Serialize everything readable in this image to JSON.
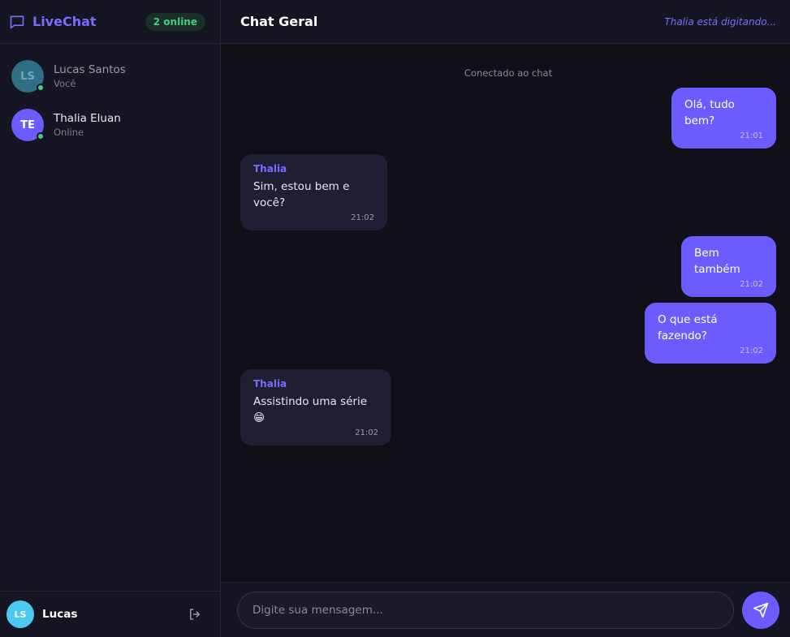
{
  "sidebar": {
    "brand": "LiveChat",
    "online_badge": "2 online",
    "users": [
      {
        "initials": "LS",
        "name": "Lucas Santos",
        "sub": "Você"
      },
      {
        "initials": "TE",
        "name": "Thalia Eluan",
        "sub": "Online"
      }
    ],
    "footer": {
      "initials": "LS",
      "name": "Lucas"
    }
  },
  "chat": {
    "title": "Chat Geral",
    "typing": "Thalia está digitando...",
    "system": "Conectado ao chat",
    "messages": [
      {
        "sender": "",
        "text": "Olá, tudo bem?",
        "time": "21:01"
      },
      {
        "sender": "Thalia",
        "text": "Sim, estou bem e você?",
        "time": "21:02"
      },
      {
        "sender": "",
        "text": "Bem também",
        "time": "21:02"
      },
      {
        "sender": "",
        "text": "O que está fazendo?",
        "time": "21:02"
      },
      {
        "sender": "Thalia",
        "text": "Assistindo uma série 😁",
        "time": "21:02"
      }
    ],
    "input_placeholder": "Digite sua mensagem..."
  },
  "colors": {
    "accent": "#6c5cff",
    "online": "#3fd07a"
  },
  "icons": {
    "brand": "chat-bubble-icon",
    "logout": "logout-icon",
    "send": "send-icon"
  }
}
